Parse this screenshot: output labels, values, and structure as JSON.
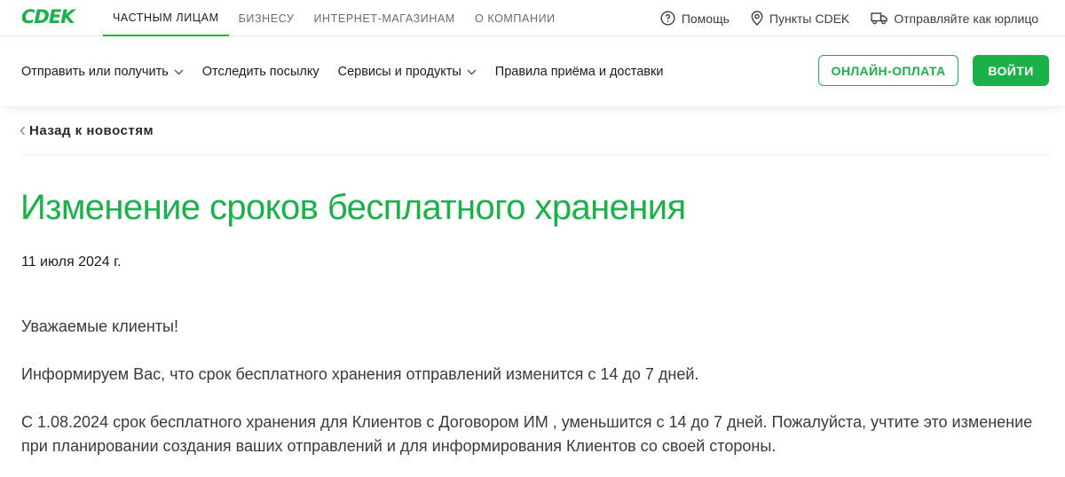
{
  "header": {
    "logo_text": "CDEK",
    "top_nav": [
      "ЧАСТНЫМ ЛИЦАМ",
      "БИЗНЕСУ",
      "ИНТЕРНЕТ-МАГАЗИНАМ",
      "О КОМПАНИИ"
    ],
    "top_links": {
      "help": "Помощь",
      "points": "Пункты CDEK",
      "legal": "Отправляйте как юрлицо"
    }
  },
  "main_nav": {
    "items": [
      "Отправить или получить",
      "Отследить посылку",
      "Сервисы и продукты",
      "Правила приёма и доставки"
    ],
    "online_payment": "ОНЛАЙН-ОПЛАТА",
    "login": "ВОЙТИ"
  },
  "article": {
    "back_label": "Назад к новостям",
    "title": "Изменение сроков бесплатного хранения",
    "date": "11 июля 2024 г.",
    "greeting": "Уважаемые клиенты!",
    "paragraph_1": "Информируем Вас, что срок бесплатного хранения отправлений изменится с 14 до 7 дней.",
    "paragraph_2": "С 1.08.2024 срок бесплатного хранения для Клиентов с Договором ИМ , уменьшится с 14 до 7 дней. Пожалуйста, учтите это изменение при планировании создания ваших отправлений и для информирования Клиентов со своей стороны."
  },
  "colors": {
    "brand_green": "#1ab248",
    "text_dark": "#1b1b1b",
    "text_muted": "#6b6b6b"
  },
  "icons": {
    "help": "question-circle-icon",
    "points": "map-pin-icon",
    "legal": "truck-icon",
    "dropdown": "chevron-down-icon",
    "back": "chevron-left-icon"
  }
}
